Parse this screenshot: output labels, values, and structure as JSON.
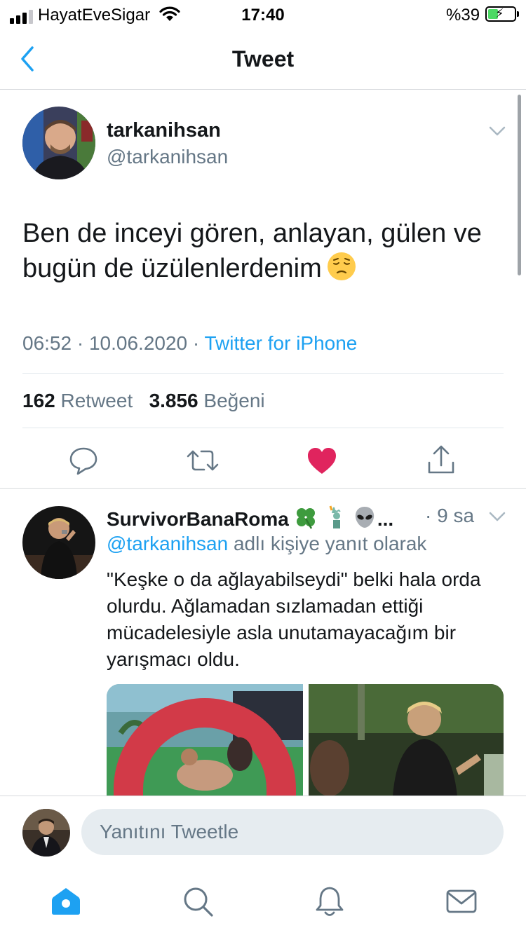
{
  "status_bar": {
    "carrier": "HayatEveSigar",
    "time": "17:40",
    "battery": "%39",
    "battery_level": 0.39
  },
  "nav": {
    "title": "Tweet",
    "back_icon": "chevron-left-icon"
  },
  "tweet": {
    "author_name": "tarkanihsan",
    "author_handle": "@tarkanihsan",
    "text": "Ben de inceyi gören, anlayan, gülen ve bugün de üzülenlerdenim",
    "emoji": "pensive-face",
    "time": "06:52",
    "date": "10.06.2020",
    "source": "Twitter for iPhone",
    "retweet_count": "162",
    "retweet_label": "Retweet",
    "like_count": "3.856",
    "like_label": "Beğeni",
    "liked": true,
    "actions": [
      "reply-icon",
      "retweet-icon",
      "like-icon",
      "share-icon"
    ]
  },
  "reply": {
    "author_name": "SurvivorBanaRoma",
    "author_emojis": [
      "four-leaf-clover",
      "statue-of-liberty",
      "alien"
    ],
    "ellipsis": "...",
    "time": "9 sa",
    "context_mention": "@tarkanihsan",
    "context_suffix": "adlı kişiye yanıt olarak",
    "text": "\"Keşke o da ağlayabilseydi\" belki hala orda olurdu. Ağlamadan sızlamadan ettiği mücadelesiyle asla unutamayacağım bir yarışmacı oldu."
  },
  "composer": {
    "placeholder": "Yanıtını Tweetle"
  },
  "tab_bar": {
    "tabs": [
      "home-icon",
      "search-icon",
      "notifications-icon",
      "messages-icon"
    ],
    "active": "home-icon"
  },
  "colors": {
    "accent": "#1da1f2",
    "like": "#e0245e",
    "secondary_text": "#657786",
    "primary_text": "#14171a"
  }
}
